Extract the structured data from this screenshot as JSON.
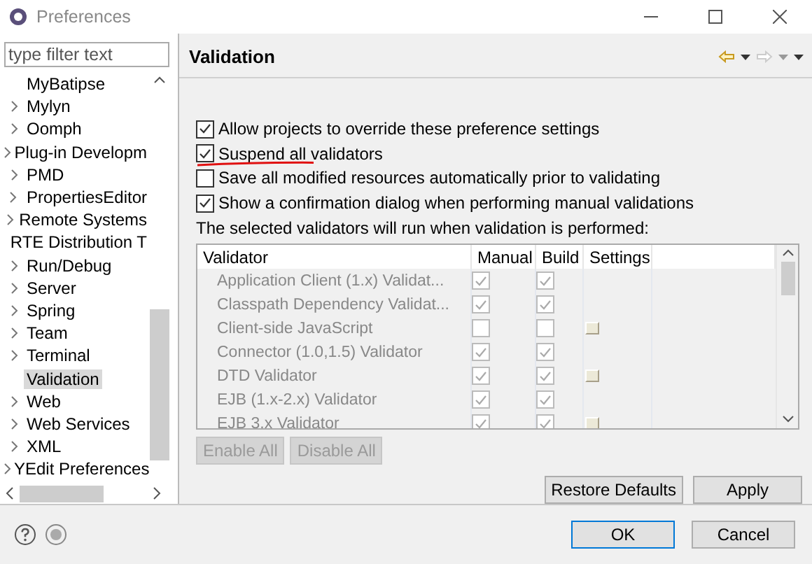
{
  "window": {
    "title": "Preferences"
  },
  "filter": {
    "placeholder": "type filter text"
  },
  "tree": [
    {
      "label": "MyBatipse",
      "expandable": false,
      "selected": false
    },
    {
      "label": "Mylyn",
      "expandable": true,
      "selected": false
    },
    {
      "label": "Oomph",
      "expandable": true,
      "selected": false
    },
    {
      "label": "Plug-in Developm",
      "expandable": true,
      "selected": false
    },
    {
      "label": "PMD",
      "expandable": true,
      "selected": false
    },
    {
      "label": "PropertiesEditor",
      "expandable": true,
      "selected": false
    },
    {
      "label": "Remote Systems",
      "expandable": true,
      "selected": false
    },
    {
      "label": "RTE Distribution T",
      "expandable": false,
      "selected": false
    },
    {
      "label": "Run/Debug",
      "expandable": true,
      "selected": false
    },
    {
      "label": "Server",
      "expandable": true,
      "selected": false
    },
    {
      "label": "Spring",
      "expandable": true,
      "selected": false
    },
    {
      "label": "Team",
      "expandable": true,
      "selected": false
    },
    {
      "label": "Terminal",
      "expandable": true,
      "selected": false
    },
    {
      "label": "Validation",
      "expandable": false,
      "selected": true
    },
    {
      "label": "Web",
      "expandable": true,
      "selected": false
    },
    {
      "label": "Web Services",
      "expandable": true,
      "selected": false
    },
    {
      "label": "XML",
      "expandable": true,
      "selected": false
    },
    {
      "label": "YEdit Preferences",
      "expandable": true,
      "selected": false
    }
  ],
  "page": {
    "title": "Validation"
  },
  "options": [
    {
      "label": "Allow projects to override these preference settings",
      "checked": true,
      "underlined": false
    },
    {
      "label": "Suspend all validators",
      "checked": true,
      "underlined": true
    },
    {
      "label": "Save all modified resources automatically prior to validating",
      "checked": false,
      "underlined": false
    },
    {
      "label": "Show a confirmation dialog when performing manual validations",
      "checked": true,
      "underlined": false
    }
  ],
  "table_caption": "The selected validators will run when validation is performed:",
  "table": {
    "disabled": true,
    "columns": [
      "Validator",
      "Manual",
      "Build",
      "Settings"
    ],
    "rows": [
      {
        "name": "Application Client (1.x) Validat...",
        "manual": true,
        "build": true,
        "settings": false
      },
      {
        "name": "Classpath Dependency Validat...",
        "manual": true,
        "build": true,
        "settings": false
      },
      {
        "name": "Client-side JavaScript",
        "manual": false,
        "build": false,
        "settings": true
      },
      {
        "name": "Connector (1.0,1.5) Validator",
        "manual": true,
        "build": true,
        "settings": false
      },
      {
        "name": "DTD Validator",
        "manual": true,
        "build": true,
        "settings": true
      },
      {
        "name": "EJB (1.x-2.x) Validator",
        "manual": true,
        "build": true,
        "settings": false
      },
      {
        "name": "EJB 3.x Validator",
        "manual": true,
        "build": true,
        "settings": true
      }
    ]
  },
  "table_buttons": [
    {
      "label": "Enable All",
      "disabled": true
    },
    {
      "label": "Disable All",
      "disabled": true
    }
  ],
  "page_buttons": [
    {
      "label": "Restore Defaults"
    },
    {
      "label": "Apply"
    }
  ],
  "dialog_buttons": [
    {
      "label": "OK",
      "default": true
    },
    {
      "label": "Cancel",
      "default": false
    }
  ]
}
